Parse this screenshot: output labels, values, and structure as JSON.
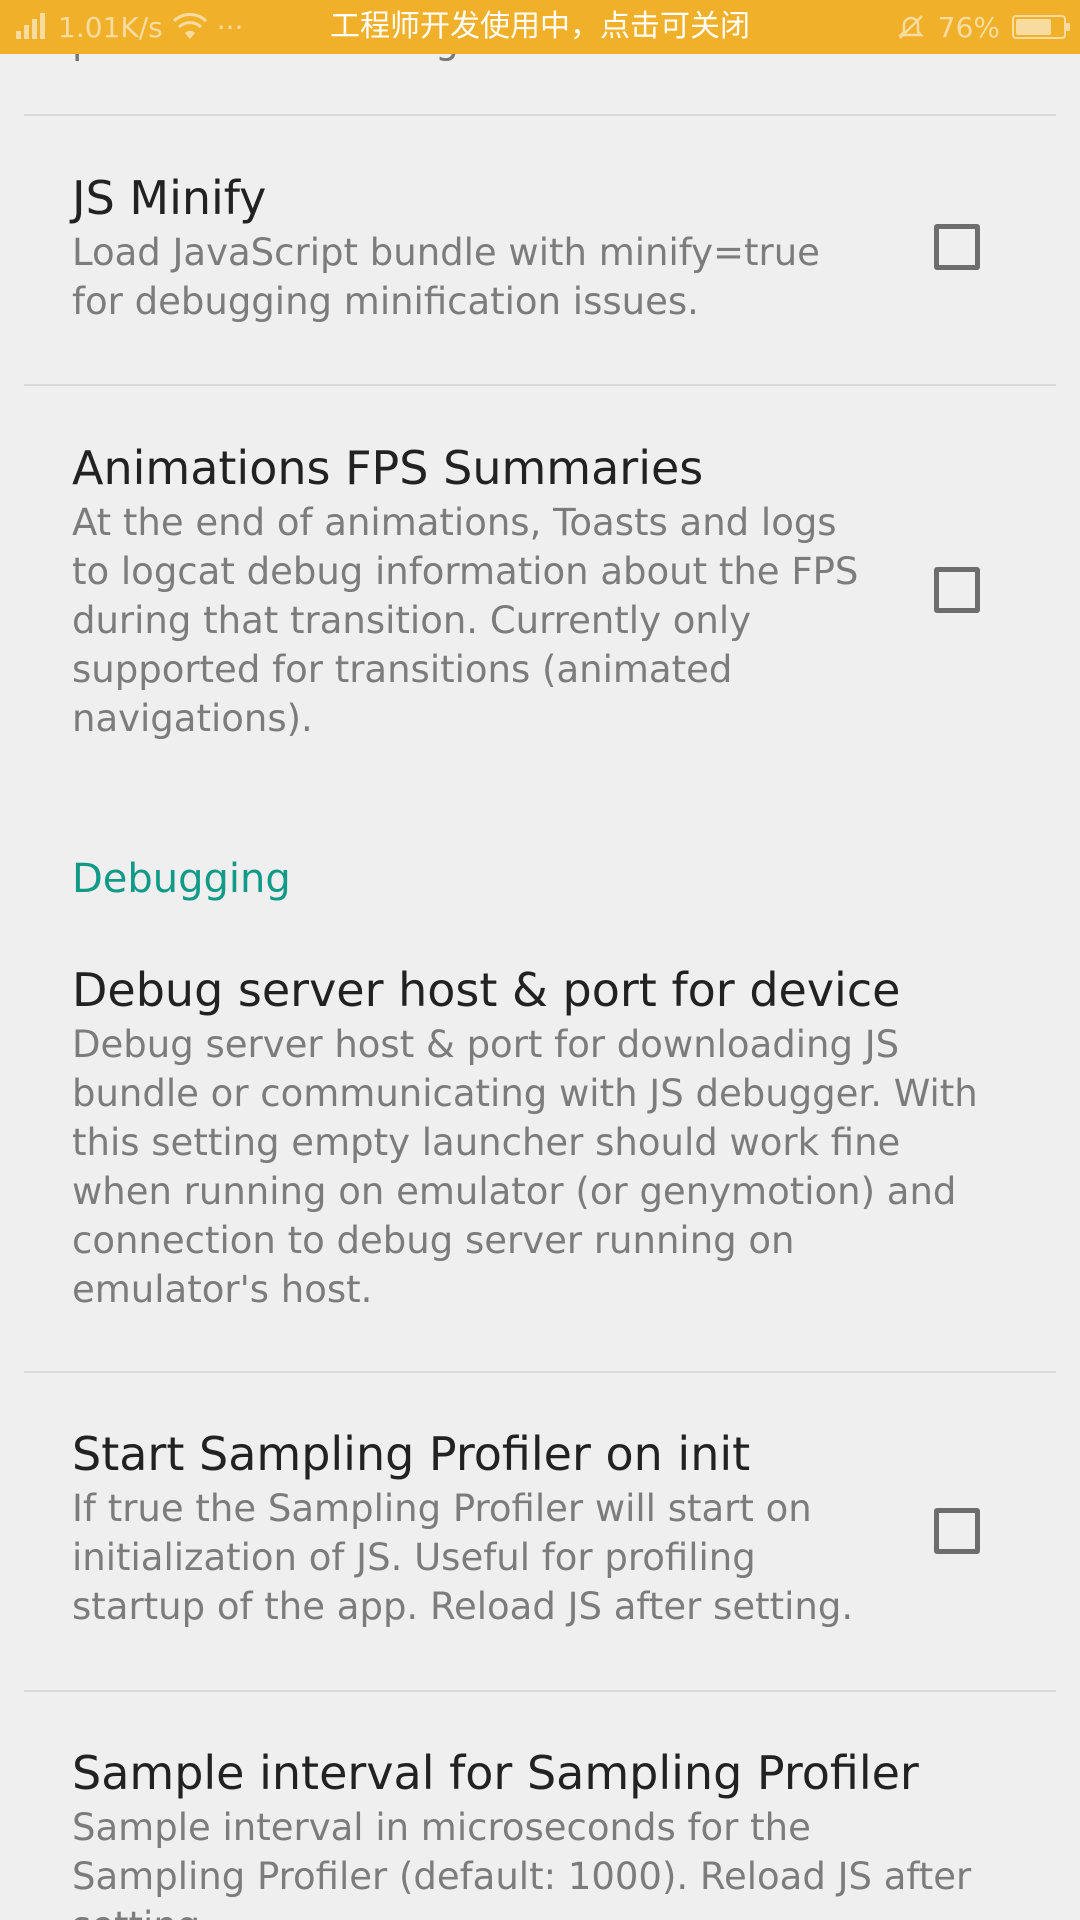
{
  "status_bar": {
    "network_speed": "1.01K/s",
    "dots": "···",
    "notice": "工程师开发使用中，点击可关闭",
    "battery_percent": "76%",
    "battery_level": 0.76,
    "icons": [
      "signal-icon",
      "wifi-icon",
      "mute-bell-icon",
      "battery-icon"
    ],
    "background_color": "#f0b02a"
  },
  "partial_top_text": "performance testing.",
  "preferences": {
    "js_minify": {
      "title": "JS Minify",
      "summary": "Load JavaScript bundle with minify=true for debugging minification issues.",
      "checked": false
    },
    "animations_fps": {
      "title": "Animations FPS Summaries",
      "summary": "At the end of animations, Toasts and logs to logcat debug information about the FPS during that transition. Currently only supported for transitions (animated navigations).",
      "checked": false
    },
    "debug_server": {
      "title": "Debug server host & port for device",
      "summary": "Debug server host & port for downloading JS bundle or communicating with JS debugger. With this setting empty launcher should work fine when running on emulator (or genymotion) and connection to debug server running on emulator's host."
    },
    "sampling_profiler": {
      "title": "Start Sampling Profiler on init",
      "summary": "If true the Sampling Profiler will start on initialization of JS. Useful for profiling startup of the app. Reload JS after setting.",
      "checked": false
    },
    "sample_interval": {
      "title": "Sample interval for Sampling Profiler",
      "summary": "Sample interval in microseconds for the Sampling Profiler (default: 1000). Reload JS after setting."
    }
  },
  "categories": {
    "debugging": "Debugging"
  },
  "colors": {
    "accent": "#129a88",
    "background": "#efefef"
  }
}
